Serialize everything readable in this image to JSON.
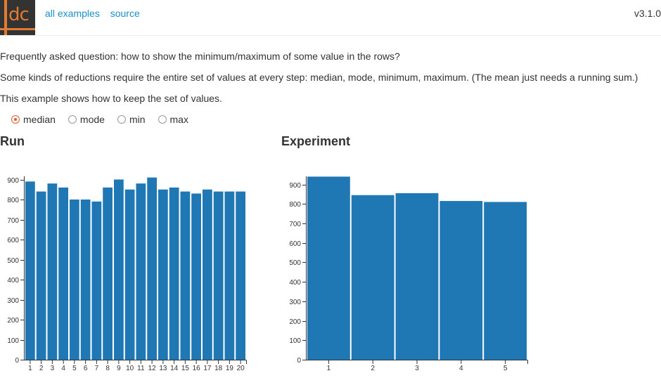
{
  "header": {
    "logo_text": "dc",
    "nav": [
      {
        "label": "all examples"
      },
      {
        "label": "source"
      }
    ],
    "version": "v3.1.0"
  },
  "intro": {
    "line1": "Frequently asked question: how to show the minimum/maximum of some value in the rows?",
    "line2": "Some kinds of reductions require the entire set of values at every step: median, mode, minimum, maximum. (The mean just needs a running sum.)",
    "line3": "This example shows how to keep the set of values."
  },
  "reducer": {
    "options": [
      {
        "label": "median",
        "checked": true
      },
      {
        "label": "mode",
        "checked": false
      },
      {
        "label": "min",
        "checked": false
      },
      {
        "label": "max",
        "checked": false
      }
    ]
  },
  "colors": {
    "bar": "#1f77b4",
    "accent": "#e05a2b",
    "link": "#1a8fc9"
  },
  "chart_data": [
    {
      "type": "bar",
      "title": "Run",
      "categories": [
        "1",
        "2",
        "3",
        "4",
        "5",
        "6",
        "7",
        "8",
        "9",
        "10",
        "11",
        "12",
        "13",
        "14",
        "15",
        "16",
        "17",
        "18",
        "19",
        "20"
      ],
      "values": [
        890,
        840,
        880,
        860,
        800,
        800,
        790,
        860,
        900,
        850,
        880,
        910,
        850,
        860,
        840,
        830,
        850,
        840,
        840,
        840
      ],
      "xlabel": "",
      "ylabel": "",
      "ylim": [
        0,
        900
      ],
      "yticks": [
        0,
        100,
        200,
        300,
        400,
        500,
        600,
        700,
        800,
        900
      ],
      "grid": false
    },
    {
      "type": "bar",
      "title": "Experiment",
      "categories": [
        "1",
        "2",
        "3",
        "4",
        "5"
      ],
      "values": [
        940,
        845,
        855,
        815,
        810
      ],
      "xlabel": "",
      "ylabel": "",
      "ylim": [
        0,
        900
      ],
      "yticks": [
        0,
        100,
        200,
        300,
        400,
        500,
        600,
        700,
        800,
        900
      ],
      "grid": false
    }
  ]
}
